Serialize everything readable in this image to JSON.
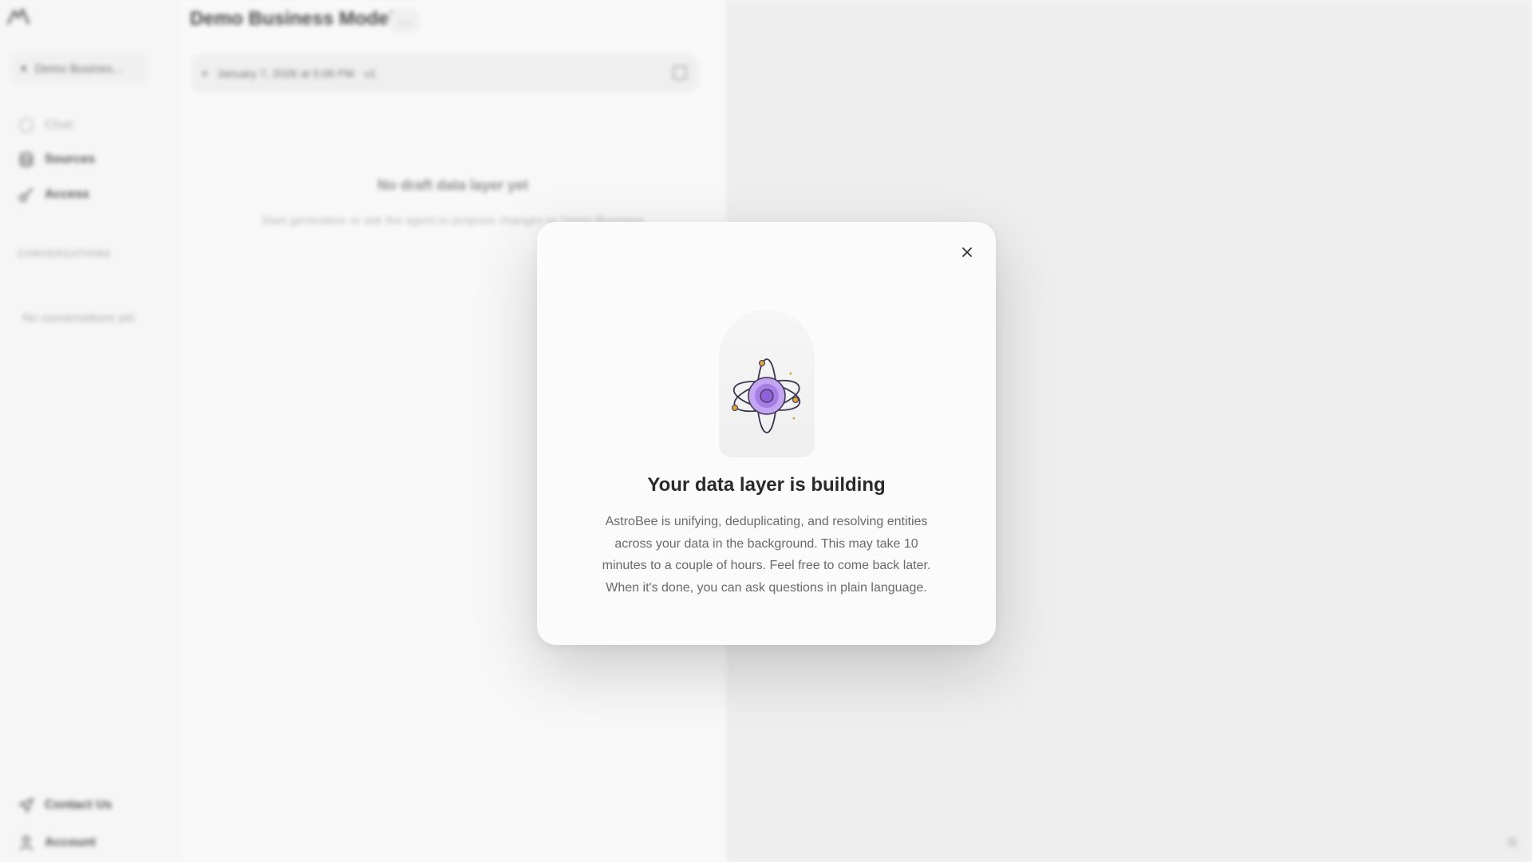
{
  "sidebar": {
    "workspace_label": "Demo Busines...",
    "nav": {
      "chat": "Chat",
      "sources": "Sources",
      "access": "Access"
    },
    "conversations_heading": "CONVERSATIONS",
    "conversations_empty": "No conversations yet",
    "contact_label": "Contact Us",
    "account_label": "Account"
  },
  "main": {
    "title": "Demo Business Model",
    "more_label": "…",
    "version_label": "January 7, 2026 at 5:06 PM · v1",
    "empty_title": "No draft data layer yet",
    "empty_subtitle": "Start generation or ask the agent to propose changes to Demo Business"
  },
  "dialog": {
    "title": "Your data layer is building",
    "body": "AstroBee is unifying, deduplicating, and resolving entities across your data in the background. This may take 10 minutes to a couple of hours. Feel free to come back later. When it's done, you can ask questions in plain language.",
    "close_icon": "close-icon",
    "illustration_icon": "atom-icon"
  },
  "colors": {
    "accent_purple": "#a77ee6",
    "accent_gold": "#d9a23a"
  }
}
